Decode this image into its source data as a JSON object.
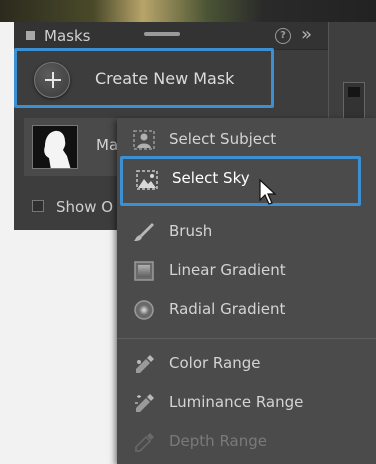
{
  "panel": {
    "title": "Masks",
    "create_mask_label": "Create New Mask",
    "mask_item_label": "Ma",
    "show_overlay_label": "Show O"
  },
  "menu": {
    "items": [
      {
        "label": "Select Subject",
        "icon": "select-subject-icon",
        "state": "normal"
      },
      {
        "label": "Select Sky",
        "icon": "select-sky-icon",
        "state": "highlighted"
      },
      {
        "label": "Brush",
        "icon": "brush-icon",
        "state": "normal"
      },
      {
        "label": "Linear Gradient",
        "icon": "linear-gradient-icon",
        "state": "normal"
      },
      {
        "label": "Radial Gradient",
        "icon": "radial-gradient-icon",
        "state": "normal"
      },
      {
        "label": "Color Range",
        "icon": "color-range-icon",
        "state": "normal"
      },
      {
        "label": "Luminance Range",
        "icon": "luminance-range-icon",
        "state": "normal"
      },
      {
        "label": "Depth Range",
        "icon": "depth-range-icon",
        "state": "disabled"
      }
    ]
  },
  "colors": {
    "highlight_border": "#3c8fd0",
    "panel_bg": "#3d3d3d",
    "menu_bg": "#4b4b4b"
  }
}
